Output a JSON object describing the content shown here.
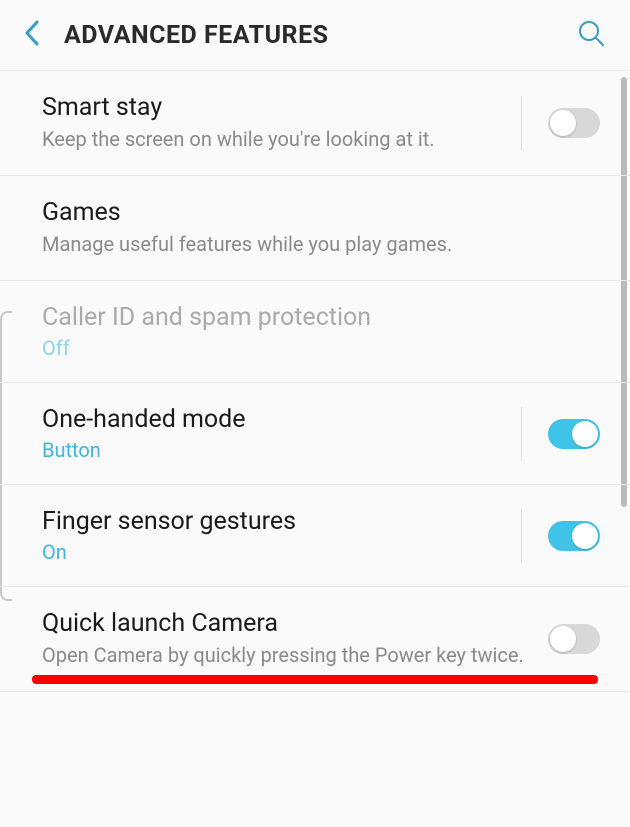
{
  "header": {
    "title": "ADVANCED FEATURES"
  },
  "items": [
    {
      "title": "Smart stay",
      "subtitle": "Keep the screen on while you're looking at it.",
      "toggle": "off",
      "hasBorder": true
    },
    {
      "title": "Games",
      "subtitle": "Manage useful features while you play games."
    },
    {
      "title": "Caller ID and spam protection",
      "status": "Off",
      "disabled": true
    },
    {
      "title": "One-handed mode",
      "status": "Button",
      "toggle": "on",
      "hasBorder": true
    },
    {
      "title": "Finger sensor gestures",
      "status": "On",
      "toggle": "on",
      "hasBorder": true
    },
    {
      "title": "Quick launch Camera",
      "subtitle": "Open Camera by quickly pressing the Power key twice.",
      "toggle": "off",
      "hasBorder": false
    }
  ]
}
